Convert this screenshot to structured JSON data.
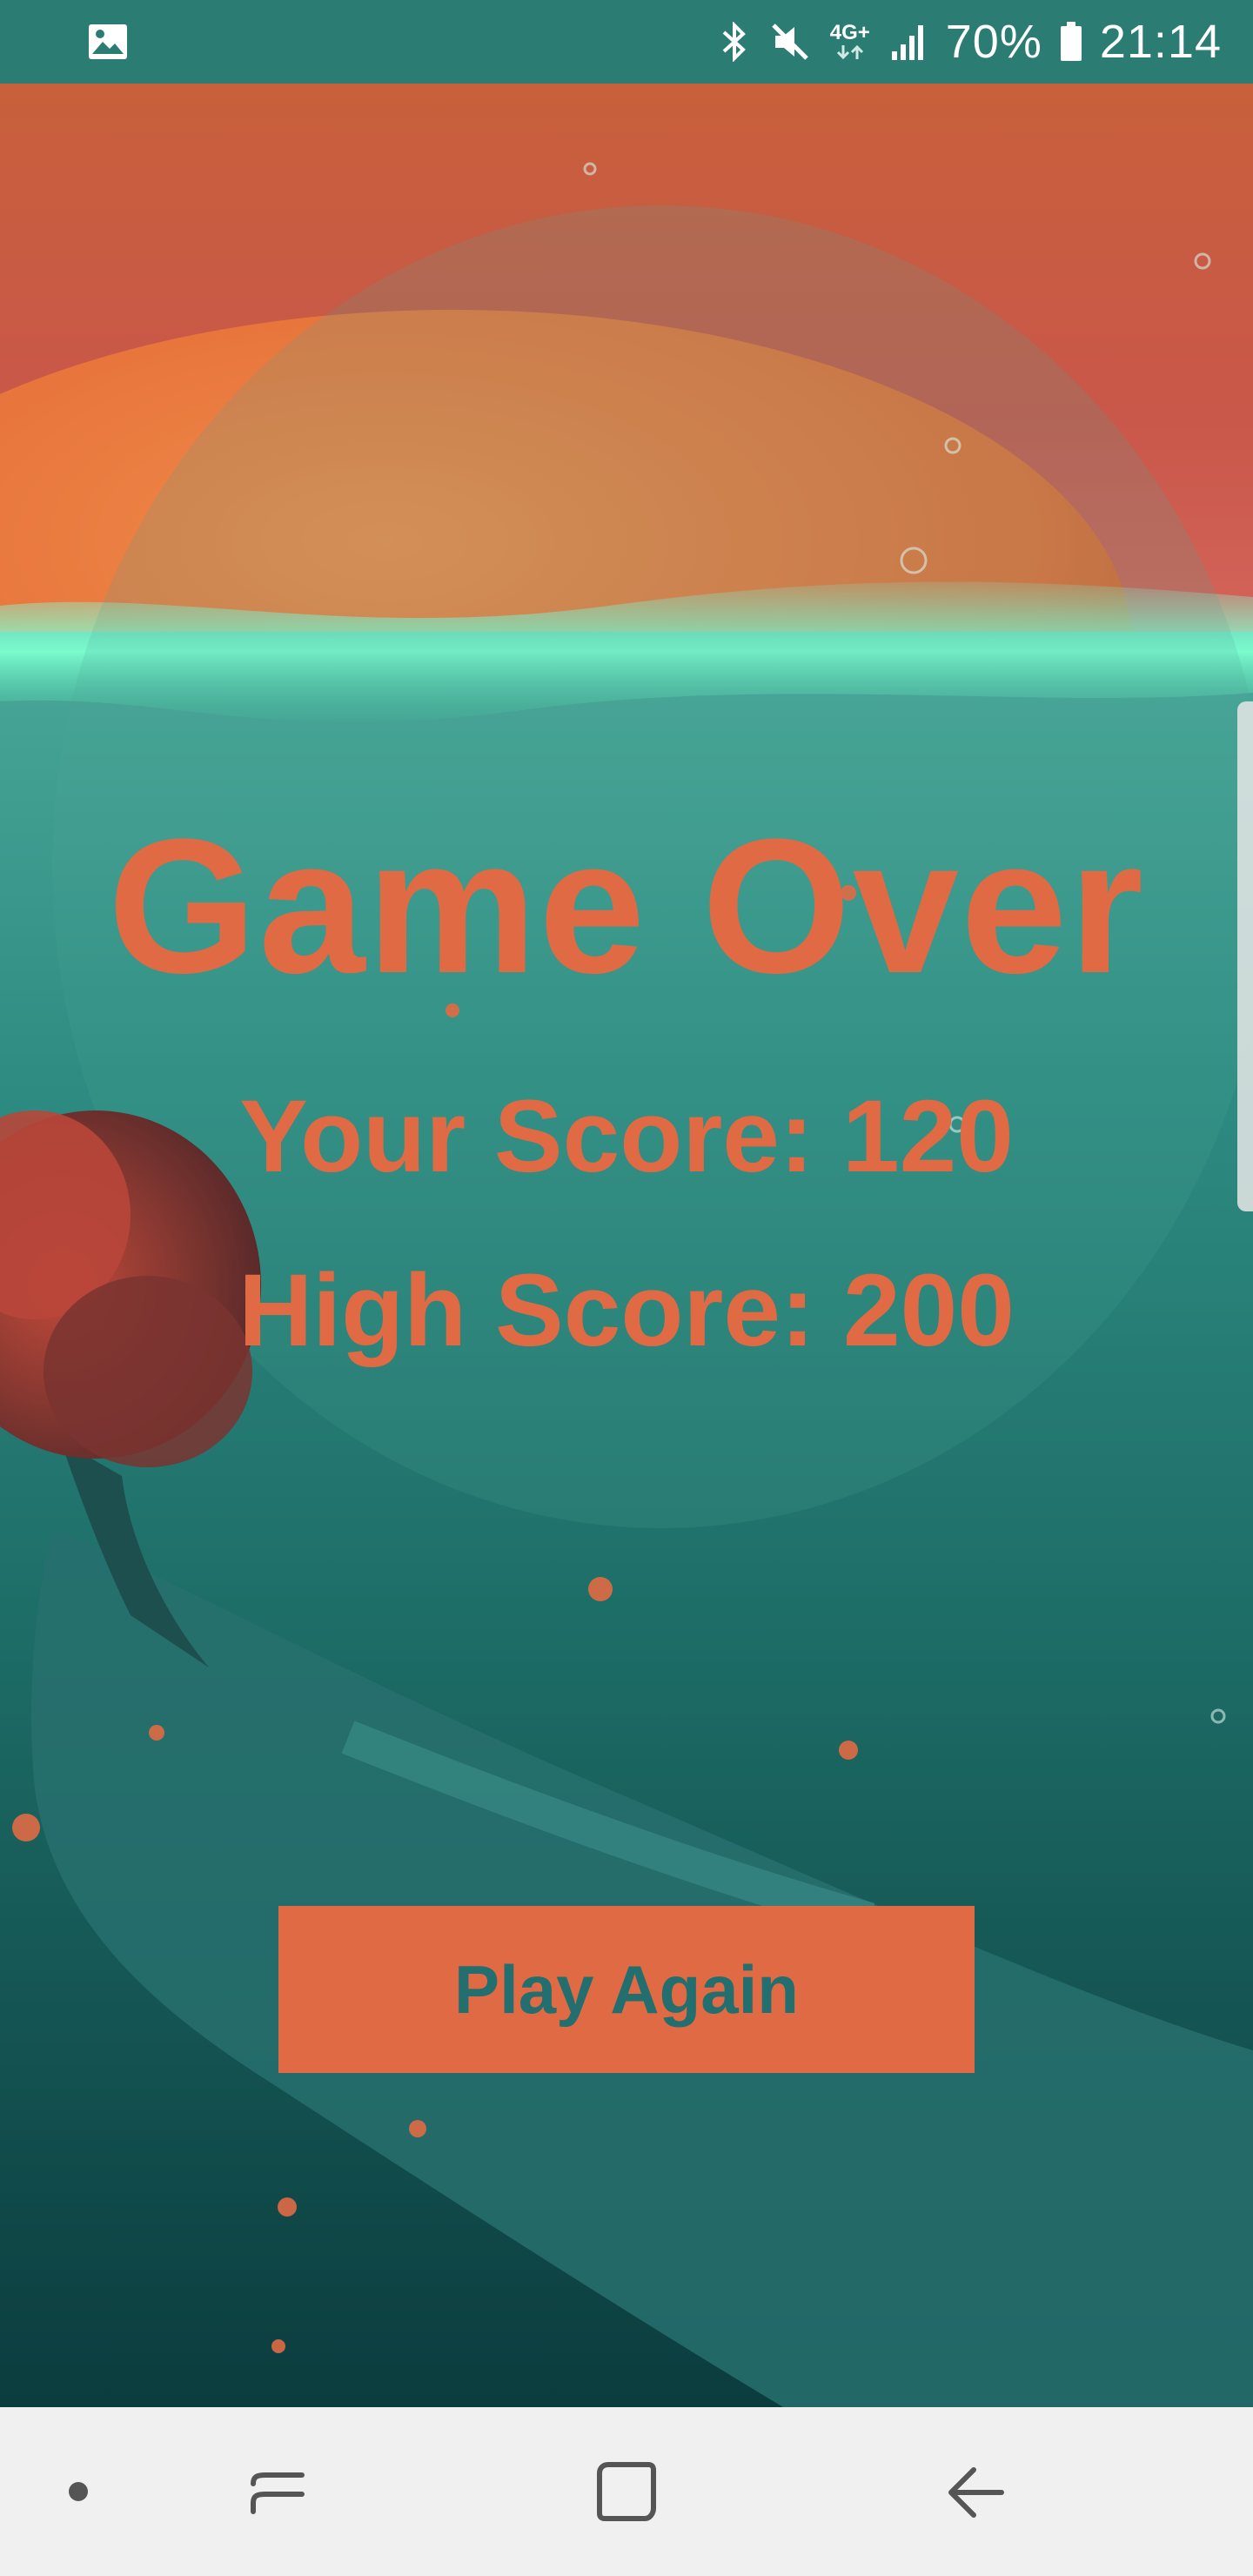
{
  "status_bar": {
    "notification_icon": "image-icon",
    "icons": [
      "bluetooth-icon",
      "mute-icon",
      "network-4g-plus-icon",
      "signal-icon",
      "battery-icon"
    ],
    "network_label": "4G+",
    "battery_percent": "70%",
    "time": "21:14"
  },
  "game_over": {
    "title": "Game Over",
    "your_score": "Your Score: 120",
    "high_score": "High Score: 200",
    "play_again_label": "Play Again"
  },
  "navigation_bar": {
    "buttons": [
      "dot-icon",
      "recents-icon",
      "home-icon",
      "back-icon"
    ]
  },
  "colors": {
    "accent": "#e06a44",
    "button_text": "#236e6e",
    "status_bar": "#2b7d74",
    "nav_bar": "#f0f0f0"
  }
}
